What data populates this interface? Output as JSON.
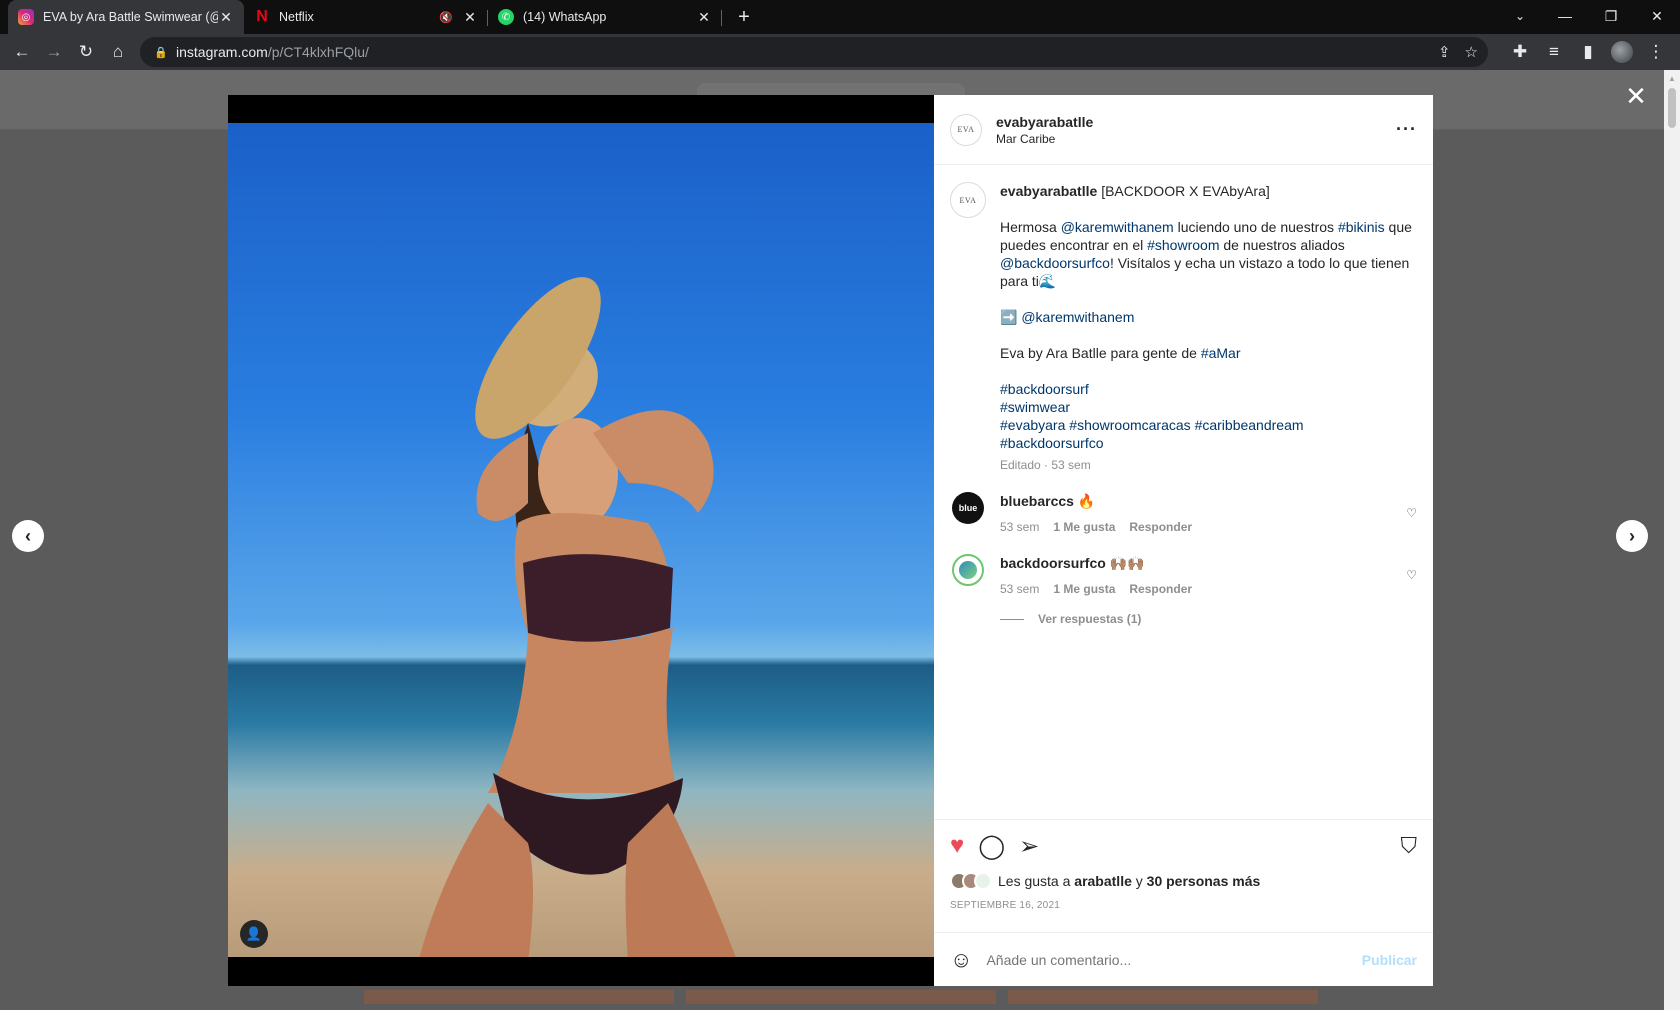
{
  "browser": {
    "tabs": [
      {
        "title": "EVA by Ara Battle Swimwear (@",
        "favicon": "instagram-icon",
        "active": true
      },
      {
        "title": "Netflix",
        "favicon": "netflix-icon",
        "audio": "🔇"
      },
      {
        "title": "(14) WhatsApp",
        "favicon": "whatsapp-icon"
      }
    ],
    "new_tab": "+",
    "url_domain": "instagram.com",
    "url_path": "/p/CT4klxhFQlu/"
  },
  "post": {
    "username": "evabyarabatlle",
    "location": "Mar Caribe",
    "logo_text": "EVA",
    "more": "···",
    "caption": {
      "title": "[BACKDOOR X EVAbyAra]",
      "p1_a": "Hermosa ",
      "p1_mention": "@karemwithanem",
      "p1_b": " luciendo uno de nuestros ",
      "p1_tag1": "#bikinis",
      "p1_c": " que puedes encontrar en el ",
      "p1_tag2": "#showroom",
      "p1_d": " de nuestros aliados ",
      "p1_mention2": "@backdoorsurfco",
      "p1_e": "! Visítalos y echa un vistazo a todo lo que tienen para ti🌊",
      "p2_arrow": "➡️ ",
      "p2_mention": "@karemwithanem",
      "p3_text": "Eva by Ara Batlle para gente de ",
      "p3_tag": "#aMar",
      "tag_line1": "#backdoorsurf",
      "tag_line2": "#swimwear",
      "tag_line3a": "#evabyara",
      "tag_line3b": "#showroomcaracas",
      "tag_line3c": "#caribbeandream",
      "tag_line4": "#backdoorsurfco",
      "edited": "Editado · 53 sem"
    },
    "comments": [
      {
        "user": "bluebarccs",
        "text": "🔥",
        "time": "53 sem",
        "likes": "1 Me gusta",
        "reply": "Responder",
        "avatar_text": "blue"
      },
      {
        "user": "backdoorsurfco",
        "text": "🙌🏽🙌🏽",
        "time": "53 sem",
        "likes": "1 Me gusta",
        "reply": "Responder"
      }
    ],
    "view_replies": "Ver respuestas (1)",
    "likes_prefix": "Les gusta a ",
    "likes_user": "arabatlle",
    "likes_mid": " y ",
    "likes_count": "30 personas más",
    "date": "SEPTIEMBRE 16, 2021",
    "comment_placeholder": "Añade un comentario...",
    "publish": "Publicar"
  }
}
